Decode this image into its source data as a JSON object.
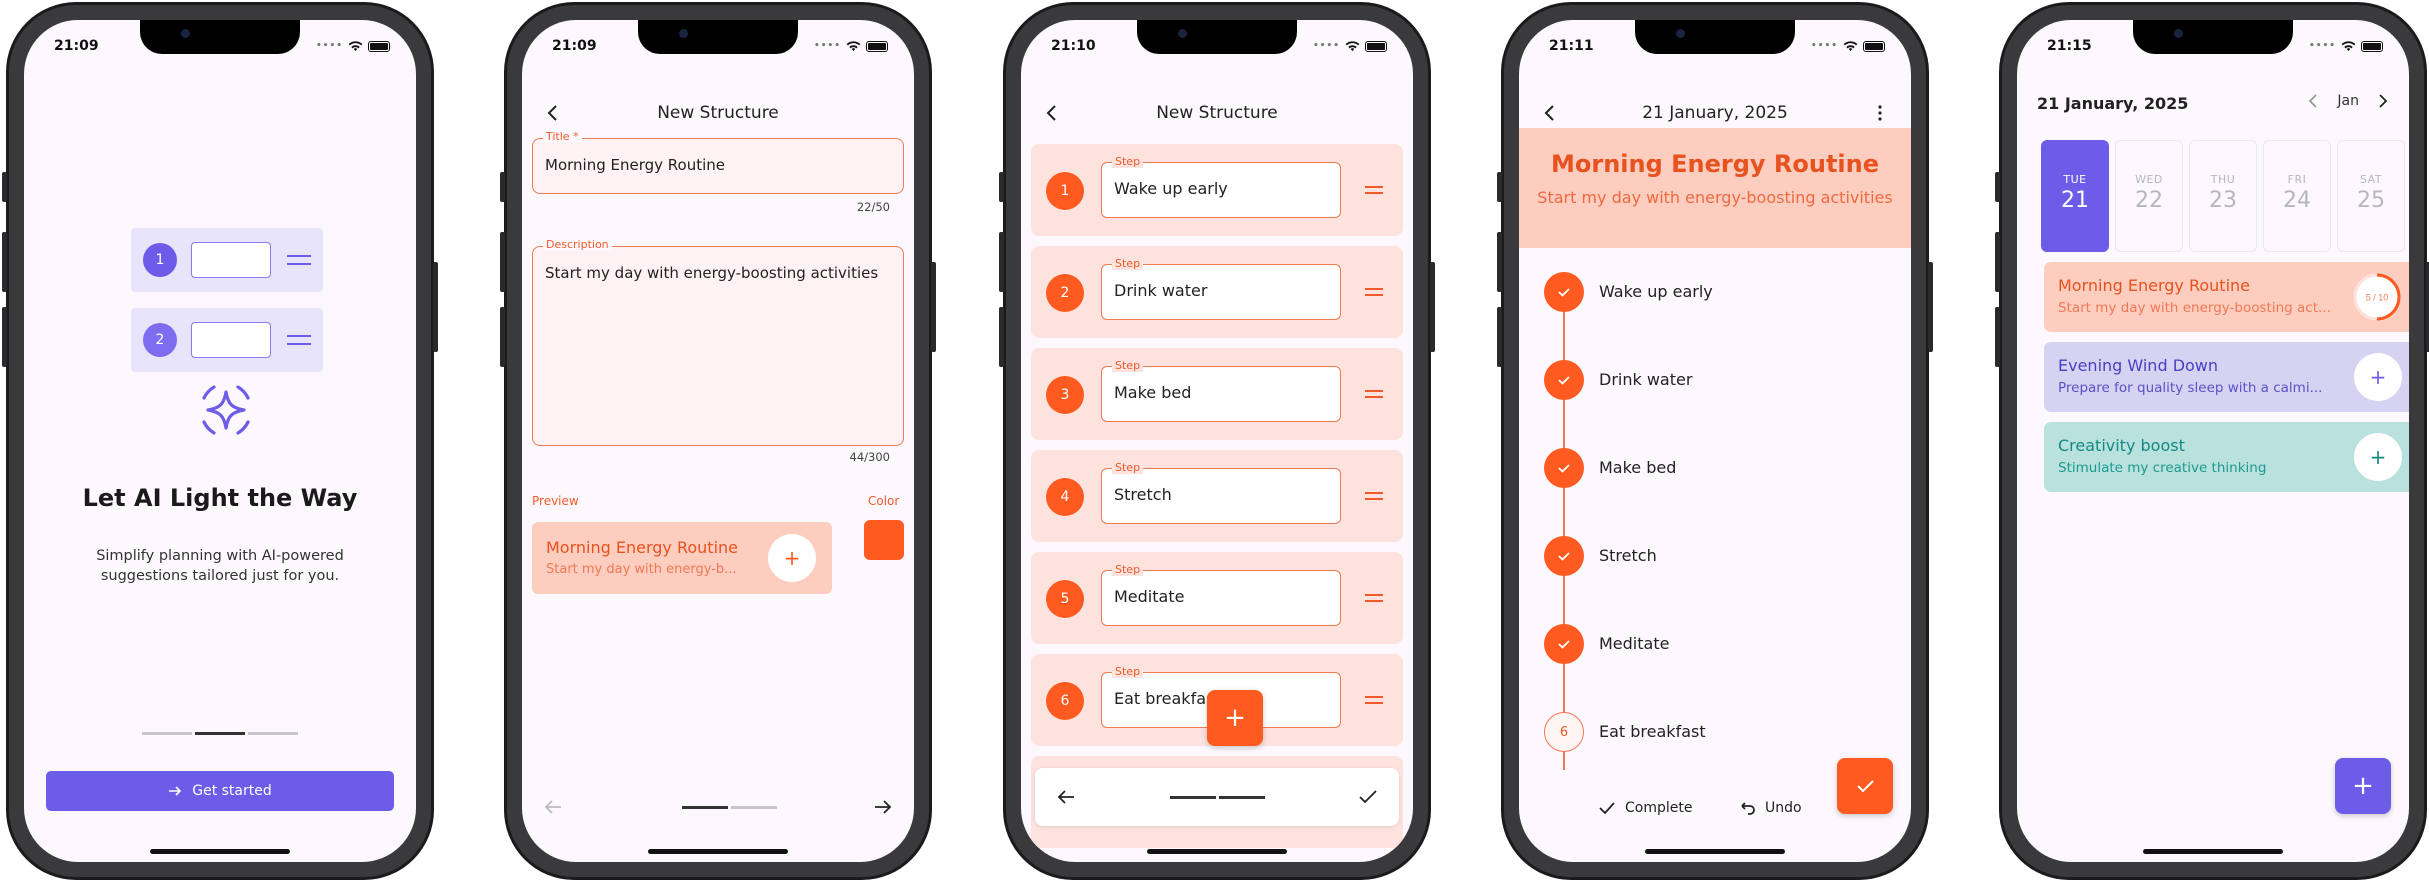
{
  "colors": {
    "accent_purple": "#6c5ce7",
    "accent_orange": "#ff5a1f",
    "card_orange": "#fdcdbf",
    "card_purple": "#d5d3f1",
    "card_teal": "#b9e1dd",
    "teal_text": "#138a82"
  },
  "screen1": {
    "time": "21:09",
    "illustration": {
      "row1_number": "1",
      "row2_number": "2"
    },
    "title": "Let AI Light the Way",
    "description": "Simplify planning with AI-powered suggestions tailored just for you.",
    "cta_label": "Get started"
  },
  "screen2": {
    "time": "21:09",
    "header": "New Structure",
    "title_field": {
      "label": "Title *",
      "value": "Morning Energy Routine",
      "counter": "22/50"
    },
    "description_field": {
      "label": "Description",
      "value": "Start my day with energy-boosting activities",
      "counter": "44/300"
    },
    "preview_label": "Preview",
    "color_label": "Color",
    "preview_card": {
      "title": "Morning Energy Routine",
      "description": "Start my day with energy-b..."
    }
  },
  "screen3": {
    "time": "21:10",
    "header": "New Structure",
    "step_label": "Step",
    "steps": [
      {
        "num": "1",
        "value": "Wake up early"
      },
      {
        "num": "2",
        "value": "Drink water"
      },
      {
        "num": "3",
        "value": "Make bed"
      },
      {
        "num": "4",
        "value": "Stretch"
      },
      {
        "num": "5",
        "value": "Meditate"
      },
      {
        "num": "6",
        "value": "Eat breakfast"
      }
    ]
  },
  "screen4": {
    "time": "21:11",
    "header": "21 January, 2025",
    "hero_title": "Morning Energy Routine",
    "hero_desc": "Start my day with energy-boosting activities",
    "items": [
      {
        "label": "Wake up early",
        "done": true
      },
      {
        "label": "Drink water",
        "done": true
      },
      {
        "label": "Make bed",
        "done": true
      },
      {
        "label": "Stretch",
        "done": true
      },
      {
        "label": "Meditate",
        "done": true
      },
      {
        "label": "Eat breakfast",
        "done": false,
        "num": "6"
      }
    ],
    "complete_label": "Complete",
    "undo_label": "Undo"
  },
  "screen5": {
    "time": "21:15",
    "date": "21 January, 2025",
    "month": "Jan",
    "days": [
      {
        "name": "TUE",
        "num": "21",
        "selected": true
      },
      {
        "name": "WED",
        "num": "22"
      },
      {
        "name": "THU",
        "num": "23"
      },
      {
        "name": "FRI",
        "num": "24"
      },
      {
        "name": "SAT",
        "num": "25"
      }
    ],
    "routines": [
      {
        "title": "Morning Energy Routine",
        "desc": "Start my day with energy-boosting act...",
        "progress_text": "5 / 10",
        "progress": 0.5
      },
      {
        "title": "Evening Wind Down",
        "desc": "Prepare for quality sleep with a calmi..."
      },
      {
        "title": "Creativity boost",
        "desc": "Stimulate my creative thinking"
      }
    ]
  }
}
